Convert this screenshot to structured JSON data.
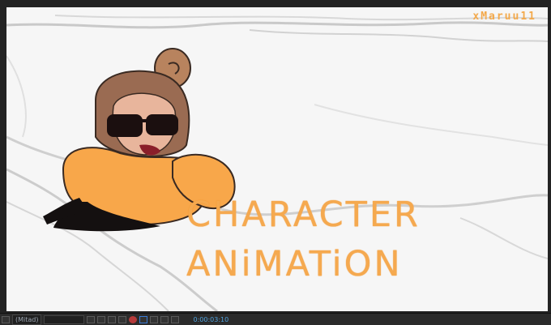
{
  "canvas": {
    "watermark": "xMaruu11",
    "title_line1": "CHARACTER",
    "title_line2": "ANiMATiON"
  },
  "toolbar": {
    "zoom_label": "(Mitad)",
    "timecode": "0:00:03:10"
  },
  "colors": {
    "accent_orange": "#f5a94f",
    "viewer_bg": "#232323",
    "timecode_blue": "#4fa3e0"
  }
}
